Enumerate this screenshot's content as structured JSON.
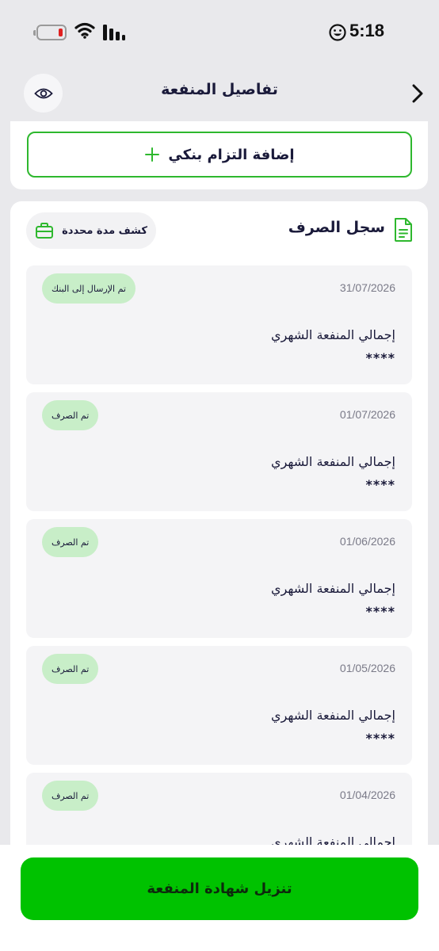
{
  "status_bar": {
    "time": "5:18"
  },
  "header": {
    "title": "تفاصيل المنفعة"
  },
  "actions": {
    "add_commitment_label": "إضافة التزام بنكي"
  },
  "history": {
    "title": "سجل الصرف",
    "period_button_label": "كشف مدة محددة",
    "entries": [
      {
        "date": "31/07/2026",
        "status": "تم الإرسال إلى البنك",
        "label": "إجمالي المنفعة الشهري",
        "amount": "****"
      },
      {
        "date": "01/07/2026",
        "status": "تم الصرف",
        "label": "إجمالي المنفعة الشهري",
        "amount": "****"
      },
      {
        "date": "01/06/2026",
        "status": "تم الصرف",
        "label": "إجمالي المنفعة الشهري",
        "amount": "****"
      },
      {
        "date": "01/05/2026",
        "status": "تم الصرف",
        "label": "إجمالي المنفعة الشهري",
        "amount": "****"
      },
      {
        "date": "01/04/2026",
        "status": "تم الصرف",
        "label": "إجمالي المنفعة الشهري",
        "amount": "****"
      }
    ]
  },
  "footer": {
    "download_label": "تنزيل شهادة المنفعة"
  },
  "icons": {
    "battery": "battery-low-icon",
    "wifi": "wifi-icon",
    "signal": "signal-icon",
    "focus": "smiley-icon",
    "visibility": "eye-icon",
    "back": "chevron-right-icon",
    "add": "plus-icon",
    "document": "document-icon",
    "briefcase": "briefcase-icon"
  },
  "colors": {
    "accent": "#00c200",
    "badge": "#c8eec8",
    "text": "#1a1a3a"
  }
}
